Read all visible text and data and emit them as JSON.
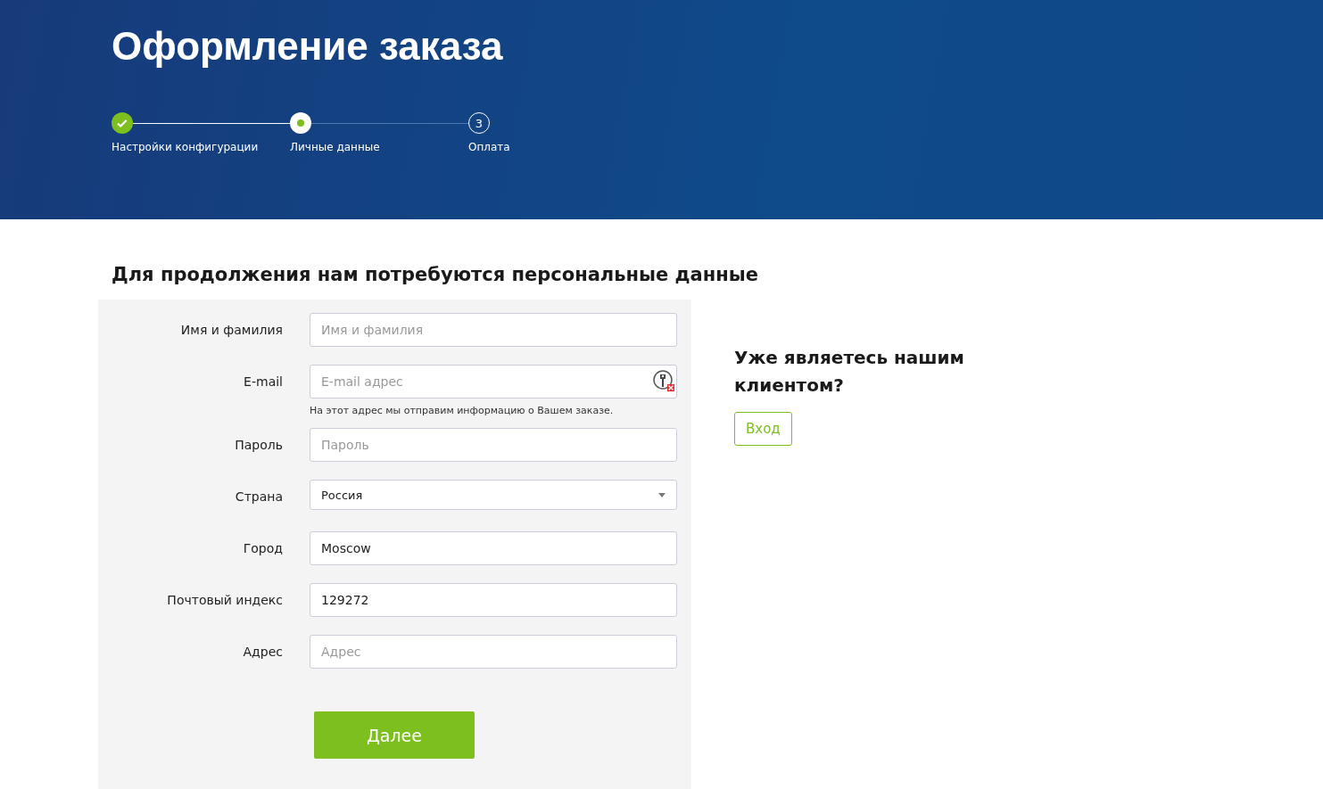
{
  "header": {
    "title": "Оформление заказа",
    "steps": [
      {
        "label": "Настройки конфигурации",
        "kind": "done"
      },
      {
        "label": "Личные данные",
        "kind": "current"
      },
      {
        "label": "Оплата",
        "kind": "pending",
        "number": "3"
      }
    ]
  },
  "form": {
    "heading": "Для продолжения нам потребуются персональные данные",
    "fields": [
      {
        "kind": "text",
        "label": "Имя и фамилия",
        "placeholder": "Имя и фамилия"
      },
      {
        "kind": "email",
        "label": "E-mail",
        "placeholder": "E-mail адрес",
        "hint": "На этот адрес мы отправим информацию о Вашем заказе."
      },
      {
        "kind": "text",
        "label": "Пароль",
        "placeholder": "Пароль"
      },
      {
        "kind": "select",
        "label": "Страна",
        "value": "Россия"
      },
      {
        "kind": "text",
        "label": "Город",
        "value": "Moscow"
      },
      {
        "kind": "text",
        "label": "Почтовый индекс",
        "value": "129272"
      },
      {
        "kind": "text",
        "label": "Адрес",
        "placeholder": "Адрес"
      }
    ],
    "submit": "Далее"
  },
  "login": {
    "heading": "Уже являетесь нашим клиентом?",
    "button": "Вход"
  }
}
